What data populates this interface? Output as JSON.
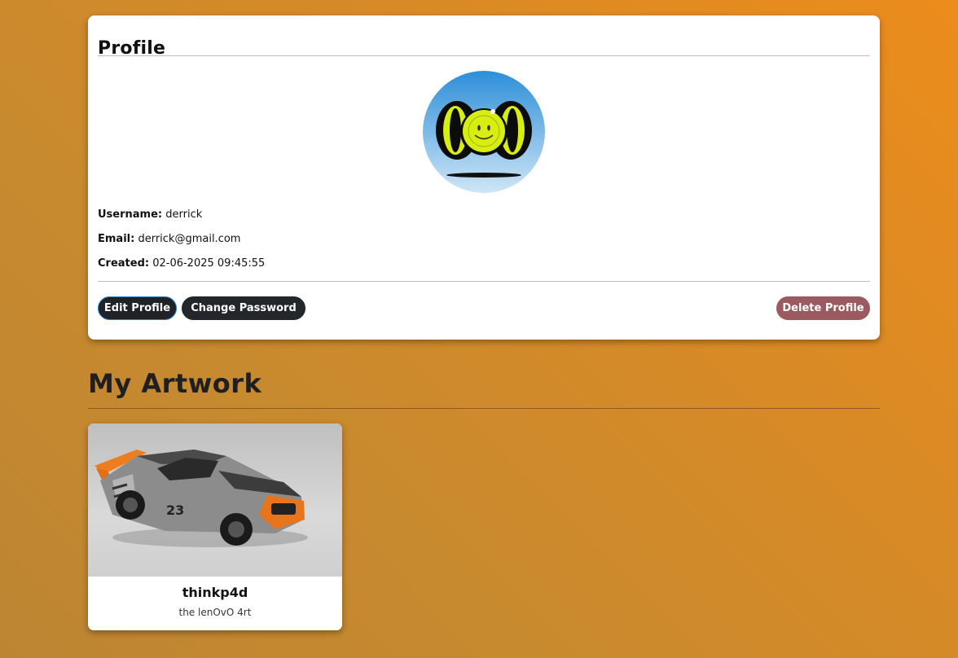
{
  "profile": {
    "title": "Profile",
    "avatar_icon": "smiley-sphere-avatar",
    "username_label": "Username:",
    "username": "derrick",
    "email_label": "Email:",
    "email": "derrick@gmail.com",
    "created_label": "Created:",
    "created": "02-06-2025 09:45:55",
    "buttons": {
      "edit": "Edit Profile",
      "change_password": "Change Password",
      "delete": "Delete Profile"
    }
  },
  "artwork": {
    "heading": "My Artwork",
    "items": [
      {
        "image_icon": "race-car-image",
        "title": "thinkp4d",
        "subtitle": "the lenOvO 4rt"
      }
    ]
  },
  "colors": {
    "bg_orange": "#ec8c1c",
    "button_dark": "#1f2328",
    "button_edit_border": "#2a7fd0",
    "button_delete": "#9a5a60"
  }
}
